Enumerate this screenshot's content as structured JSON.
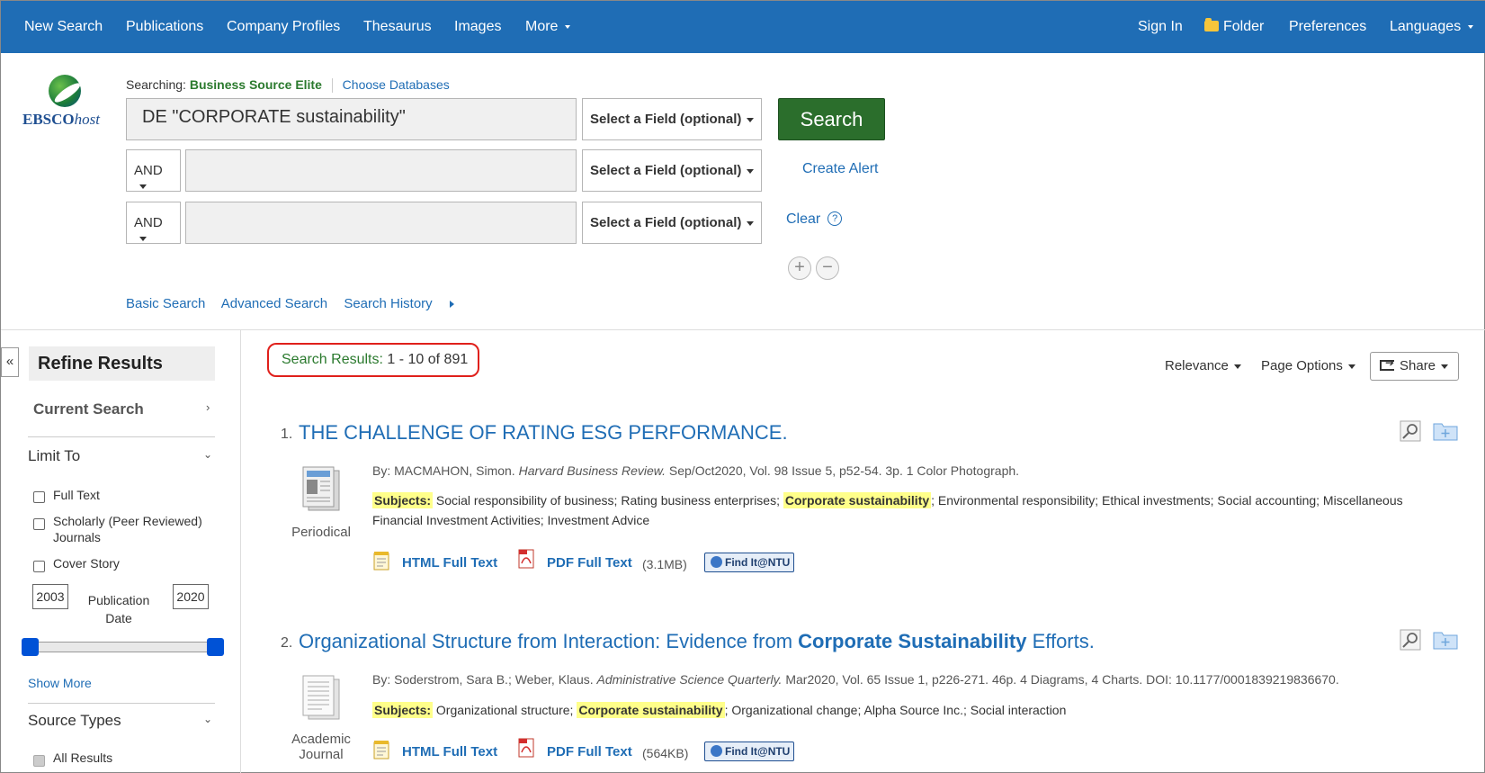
{
  "nav": {
    "new_search": "New Search",
    "publications": "Publications",
    "company_profiles": "Company Profiles",
    "thesaurus": "Thesaurus",
    "images": "Images",
    "more": "More",
    "sign_in": "Sign In",
    "folder": "Folder",
    "preferences": "Preferences",
    "languages": "Languages"
  },
  "logo": {
    "brand_bold": "EBSCO",
    "brand_italic": "host"
  },
  "search": {
    "searching_label": "Searching:",
    "database": "Business Source Elite",
    "choose_databases": "Choose Databases",
    "query_1": "DE \"CORPORATE sustainability\"",
    "query_2": "",
    "query_3": "",
    "bool_2": "AND",
    "bool_3": "AND",
    "field_select": "Select a Field (optional)",
    "search_button": "Search",
    "create_alert": "Create Alert",
    "clear": "Clear",
    "help": "?",
    "add_row": "+",
    "remove_row": "−",
    "basic_search": "Basic Search",
    "advanced_search": "Advanced Search",
    "search_history": "Search History"
  },
  "sidebar": {
    "collapse": "«",
    "refine_results": "Refine Results",
    "current_search": "Current Search",
    "limit_to": "Limit To",
    "full_text": "Full Text",
    "scholarly_1": "Scholarly (Peer Reviewed)",
    "scholarly_2": "Journals",
    "cover_story": "Cover Story",
    "year_from": "2003",
    "year_to": "2020",
    "pub_date_1": "Publication",
    "pub_date_2": "Date",
    "slider_range": [
      2003,
      2020
    ],
    "show_more": "Show More",
    "source_types": "Source Types",
    "all_results": "All Results"
  },
  "results_header": {
    "label": "Search Results:",
    "range": "1 - 10 of 891",
    "relevance": "Relevance",
    "page_options": "Page Options",
    "share": "Share"
  },
  "results": [
    {
      "num": "1.",
      "title": "THE CHALLENGE OF RATING ESG PERFORMANCE.",
      "type": "Periodical",
      "by": "By: MACMAHON, Simon.",
      "journal": "Harvard Business Review.",
      "details": "Sep/Oct2020, Vol. 98 Issue 5, p52-54. 3p. 1 Color Photograph.",
      "subjects_label": "Subjects:",
      "subjects_pre": "Social responsibility of business; Rating business enterprises;",
      "subjects_hl": "Corporate sustainability",
      "subjects_post": "; Environmental responsibility; Ethical investments; Social accounting; Miscellaneous Financial Investment Activities; Investment Advice",
      "html_ft": "HTML Full Text",
      "pdf_ft": "PDF Full Text",
      "pdf_size": "(3.1MB)",
      "find_it": "Find It@NTU"
    },
    {
      "num": "2.",
      "title_pre": "Organizational Structure from Interaction: Evidence from",
      "title_hl": "Corporate Sustainability",
      "title_post": "Efforts.",
      "type_1": "Academic",
      "type_2": "Journal",
      "by": "By: Soderstrom, Sara B.; Weber, Klaus.",
      "journal": "Administrative Science Quarterly.",
      "details": "Mar2020, Vol. 65 Issue 1, p226-271. 46p. 4 Diagrams, 4 Charts. DOI: 10.1177/0001839219836670.",
      "subjects_label": "Subjects:",
      "subjects_pre": "Organizational structure;",
      "subjects_hl": "Corporate sustainability",
      "subjects_post": "; Organizational change; Alpha Source Inc.; Social interaction",
      "html_ft": "HTML Full Text",
      "pdf_ft": "PDF Full Text",
      "pdf_size": "(564KB)",
      "find_it": "Find It@NTU"
    }
  ],
  "colors": {
    "nav_bg": "#1f6db5",
    "search_button": "#2b6e2c",
    "database_name": "#2b7a2e",
    "link": "#1f6db5",
    "highlight": "#ffff8a",
    "results_circle": "#e0201b"
  }
}
